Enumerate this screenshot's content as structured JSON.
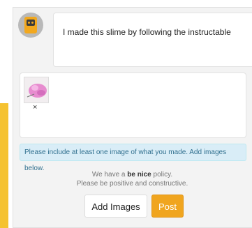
{
  "comment": {
    "text": "I made this slime by following the instructable"
  },
  "attachments": {
    "remove_label": "×"
  },
  "notice": {
    "text": "Please include at least one image of what you made. Add images below."
  },
  "policy": {
    "prefix": "We have a ",
    "emphasis": "be nice",
    "suffix": " policy.",
    "line2": "Please be positive and constructive."
  },
  "buttons": {
    "add_images": "Add Images",
    "post": "Post"
  },
  "colors": {
    "accent": "#f5c230",
    "post_button": "#f0a51f",
    "notice_bg": "#d9edf7",
    "notice_text": "#31708f"
  },
  "icons": {
    "avatar": "robot-avatar-icon",
    "thumbnail": "pink-slime-image"
  }
}
